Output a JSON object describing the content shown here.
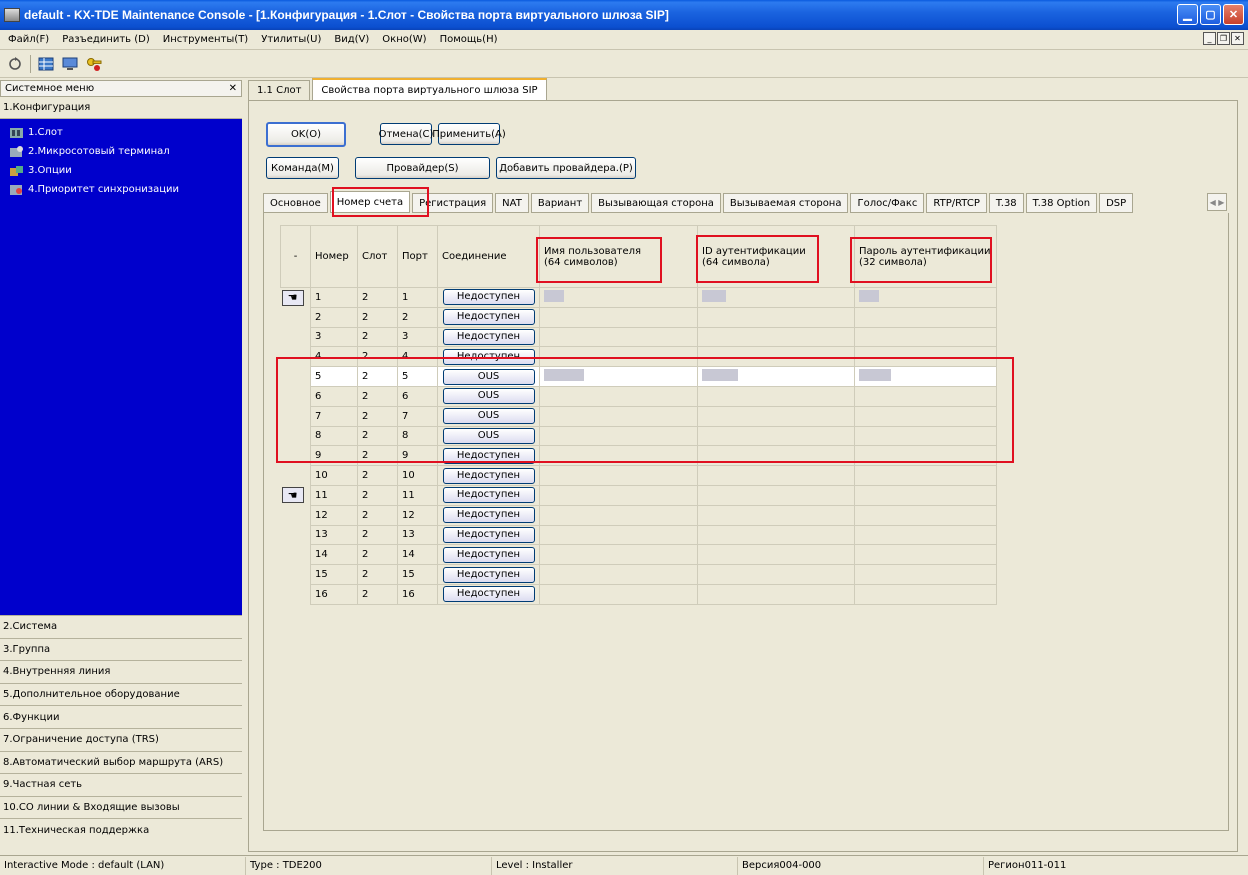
{
  "window": {
    "title": "default - KX-TDE Maintenance Console - [1.Конфигурация - 1.Слот - Свойства порта виртуального шлюза SIP]"
  },
  "menu": [
    "Файл(F)",
    "Разъединить (D)",
    "Инструменты(T)",
    "Утилиты(U)",
    "Вид(V)",
    "Окно(W)",
    "Помощь(H)"
  ],
  "toolbar": {
    "icons": [
      "refresh-icon",
      "grid-icon",
      "monitor-icon",
      "key-icon"
    ]
  },
  "sidebar": {
    "header": "Системное меню",
    "close_glyph": "✕",
    "section_title": "1.Конфигурация",
    "tree_items": [
      "1.Слот",
      "2.Микросотовый терминал",
      "3.Опции",
      "4.Приоритет синхронизации"
    ],
    "nav_items": [
      "2.Система",
      "3.Группа",
      "4.Внутренняя линия",
      "5.Дополнительное оборудование",
      "6.Функции",
      "7.Ограничение доступа (TRS)",
      "8.Автоматический выбор маршрута (ARS)",
      "9.Частная сеть",
      "10.CO линии & Входящие вызовы",
      "11.Техническая поддержка"
    ]
  },
  "top_tabs": [
    "1.1 Слот",
    "Свойства порта виртуального шлюза SIP"
  ],
  "buttons": {
    "ok": "OK(O)",
    "cancel": "Отмена(C)",
    "apply": "Применить(A)",
    "command": "Команда(M)",
    "provider": "Провайдер(S)",
    "add_provider": "Добавить провайдера.(P)"
  },
  "sub_tabs": [
    "Основное",
    "Номер счета",
    "Регистрация",
    "NAT",
    "Вариант",
    "Вызывающая сторона",
    "Вызываемая сторона",
    "Голос/Факс",
    "RTP/RTCP",
    "T.38",
    "T.38 Option",
    "DSP"
  ],
  "active_sub_tab": "Номер счета",
  "table": {
    "select_header": "-",
    "headers": [
      "Номер",
      "Слот",
      "Порт",
      "Соединение",
      "Имя пользователя\n(64 символов)",
      "ID аутентификации\n(64 символа)",
      "Пароль аутентификации\n(32 символа)"
    ],
    "rows": [
      {
        "num": "1",
        "slot": "2",
        "port": "1",
        "conn": "Недоступен"
      },
      {
        "num": "2",
        "slot": "2",
        "port": "2",
        "conn": "Недоступен"
      },
      {
        "num": "3",
        "slot": "2",
        "port": "3",
        "conn": "Недоступен"
      },
      {
        "num": "4",
        "slot": "2",
        "port": "4",
        "conn": "Недоступен"
      },
      {
        "num": "5",
        "slot": "2",
        "port": "5",
        "conn": "OUS"
      },
      {
        "num": "6",
        "slot": "2",
        "port": "6",
        "conn": "OUS"
      },
      {
        "num": "7",
        "slot": "2",
        "port": "7",
        "conn": "OUS"
      },
      {
        "num": "8",
        "slot": "2",
        "port": "8",
        "conn": "OUS"
      },
      {
        "num": "9",
        "slot": "2",
        "port": "9",
        "conn": "Недоступен"
      },
      {
        "num": "10",
        "slot": "2",
        "port": "10",
        "conn": "Недоступен"
      },
      {
        "num": "11",
        "slot": "2",
        "port": "11",
        "conn": "Недоступен"
      },
      {
        "num": "12",
        "slot": "2",
        "port": "12",
        "conn": "Недоступен"
      },
      {
        "num": "13",
        "slot": "2",
        "port": "13",
        "conn": "Недоступен"
      },
      {
        "num": "14",
        "slot": "2",
        "port": "14",
        "conn": "Недоступен"
      },
      {
        "num": "15",
        "slot": "2",
        "port": "15",
        "conn": "Недоступен"
      },
      {
        "num": "16",
        "slot": "2",
        "port": "16",
        "conn": "Недоступен"
      }
    ]
  },
  "status": {
    "mode": "Interactive Mode : default (LAN)",
    "type": "Type : TDE200",
    "level": "Level : Installer",
    "version": "Версия004-000",
    "region": "Регион011-011"
  },
  "colors": {
    "tree_bg": "#0000cc",
    "highlight": "#e01020",
    "title_bar": "#0b4fd0"
  }
}
